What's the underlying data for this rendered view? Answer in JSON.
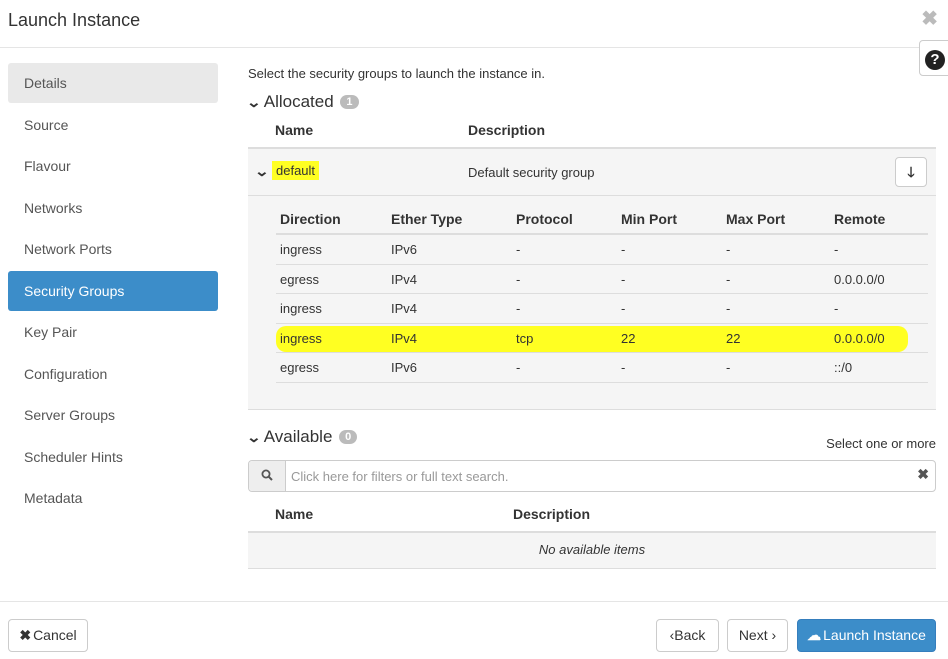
{
  "window": {
    "title": "Launch Instance"
  },
  "sidebar": {
    "items": [
      {
        "label": "Details"
      },
      {
        "label": "Source"
      },
      {
        "label": "Flavour"
      },
      {
        "label": "Networks"
      },
      {
        "label": "Network Ports"
      },
      {
        "label": "Security Groups"
      },
      {
        "label": "Key Pair"
      },
      {
        "label": "Configuration"
      },
      {
        "label": "Server Groups"
      },
      {
        "label": "Scheduler Hints"
      },
      {
        "label": "Metadata"
      }
    ],
    "active": "Security Groups"
  },
  "main": {
    "intro": "Select the security groups to launch the instance in.",
    "allocated": {
      "title": "Allocated",
      "count": "1",
      "columns": [
        "Name",
        "Description"
      ],
      "group": {
        "name": "default",
        "description": "Default security group"
      },
      "rules": {
        "columns": [
          "Direction",
          "Ether Type",
          "Protocol",
          "Min Port",
          "Max Port",
          "Remote"
        ],
        "rows": [
          [
            "ingress",
            "IPv6",
            "-",
            "-",
            "-",
            "-"
          ],
          [
            "egress",
            "IPv4",
            "-",
            "-",
            "-",
            "0.0.0.0/0"
          ],
          [
            "ingress",
            "IPv4",
            "-",
            "-",
            "-",
            "-"
          ],
          [
            "ingress",
            "IPv4",
            "tcp",
            "22",
            "22",
            "0.0.0.0/0"
          ],
          [
            "egress",
            "IPv6",
            "-",
            "-",
            "-",
            "::/0"
          ]
        ]
      }
    },
    "available": {
      "title": "Available",
      "count": "0",
      "select_hint": "Select one or more",
      "search_placeholder": "Click here for filters or full text search.",
      "columns": [
        "Name",
        "Description"
      ],
      "empty_text": "No available items"
    }
  },
  "footer": {
    "cancel": "Cancel",
    "back": "Back",
    "next": "Next",
    "launch": "Launch Instance"
  },
  "colors": {
    "primary": "#3c8dc9",
    "highlight": "#ffff22"
  }
}
